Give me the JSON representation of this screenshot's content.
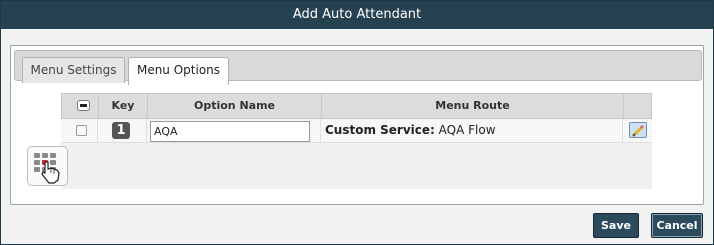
{
  "dialog": {
    "title": "Add Auto Attendant"
  },
  "tabs": [
    {
      "label": "Menu Settings",
      "active": false
    },
    {
      "label": "Menu Options",
      "active": true
    }
  ],
  "table": {
    "headers": {
      "key": "Key",
      "option_name": "Option Name",
      "menu_route": "Menu Route"
    },
    "rows": [
      {
        "key": "1",
        "option_name": "AQA",
        "route_type": "Custom Service:",
        "route_value": "AQA Flow"
      }
    ]
  },
  "buttons": {
    "save": "Save",
    "cancel": "Cancel"
  },
  "icons": {
    "deselect_all": "minus-checkbox-icon",
    "edit": "edit-pencil-icon",
    "add_option": "keypad-hand-icon"
  },
  "colors": {
    "titlebar": "#264150",
    "button": "#2b4a5c"
  }
}
